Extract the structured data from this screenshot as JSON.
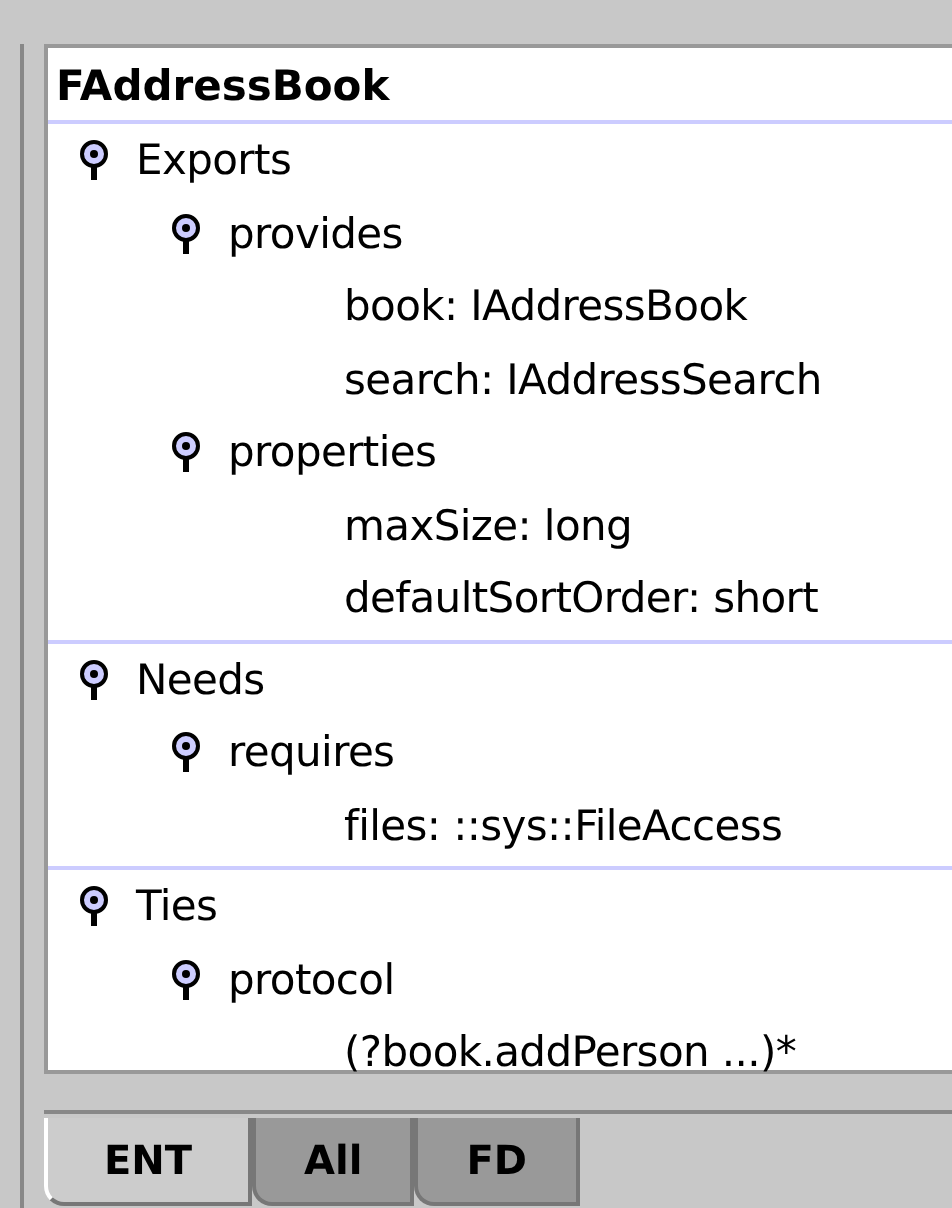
{
  "title": "FAddressBook",
  "sections": [
    {
      "label": "Exports",
      "children": [
        {
          "label": "provides",
          "children": [
            {
              "label": "book: IAddressBook"
            },
            {
              "label": "search: IAddressSearch"
            }
          ]
        },
        {
          "label": "properties",
          "children": [
            {
              "label": "maxSize: long"
            },
            {
              "label": "defaultSortOrder: short"
            }
          ]
        }
      ]
    },
    {
      "label": "Needs",
      "children": [
        {
          "label": "requires",
          "children": [
            {
              "label": "files: ::sys::FileAccess"
            }
          ]
        }
      ]
    },
    {
      "label": "Ties",
      "children": [
        {
          "label": "protocol",
          "children": [
            {
              "label": "(?book.addPerson ...)*"
            }
          ]
        }
      ]
    }
  ],
  "tabs": [
    {
      "label": "ENT",
      "selected": true
    },
    {
      "label": "All",
      "selected": false
    },
    {
      "label": "FD",
      "selected": false
    }
  ]
}
